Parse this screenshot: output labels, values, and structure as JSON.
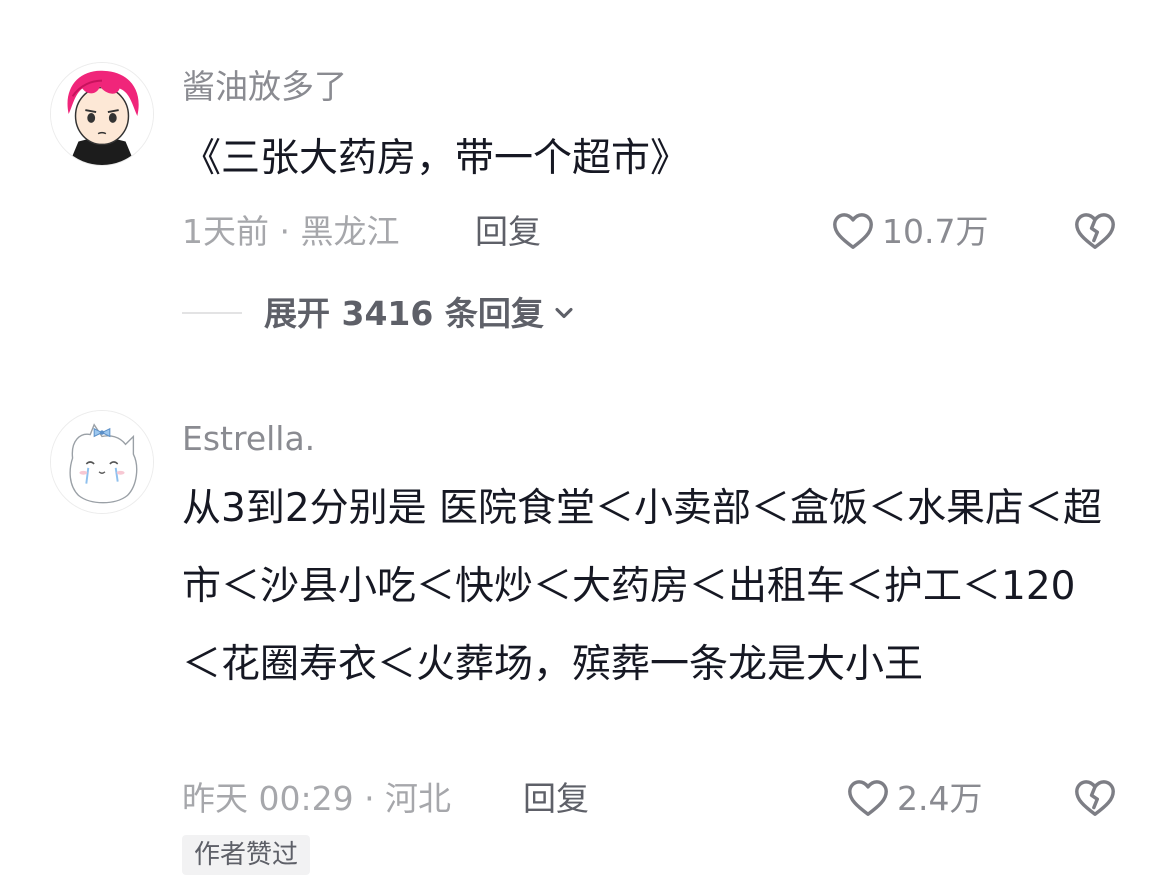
{
  "comments": [
    {
      "username": "酱油放多了",
      "text": "《三张大药房，带一个超市》",
      "meta": "1天前 · 黑龙江",
      "reply_label": "回复",
      "like_count": "10.7万",
      "expand_label": "展开 3416 条回复"
    },
    {
      "username": "Estrella.",
      "text": "从3到2分别是 医院食堂＜小卖部＜盒饭＜水果店＜超市＜沙县小吃＜快炒＜大药房＜出租车＜护工＜120＜花圈寿衣＜火葬场，殡葬一条龙是大小王",
      "meta": "昨天 00:29 · 河北",
      "reply_label": "回复",
      "like_count": "2.4万",
      "badge": "作者赞过"
    }
  ],
  "icons": {
    "like": "heart-outline-icon",
    "dislike": "broken-heart-icon",
    "expand": "chevron-down-icon"
  },
  "colors": {
    "primary_text": "#161823",
    "secondary_text": "#8a8b91",
    "meta_text": "#a6a7ab",
    "action_text": "#5e6068",
    "badge_bg": "#f2f2f3",
    "avatar_hair": "#f0257a"
  }
}
